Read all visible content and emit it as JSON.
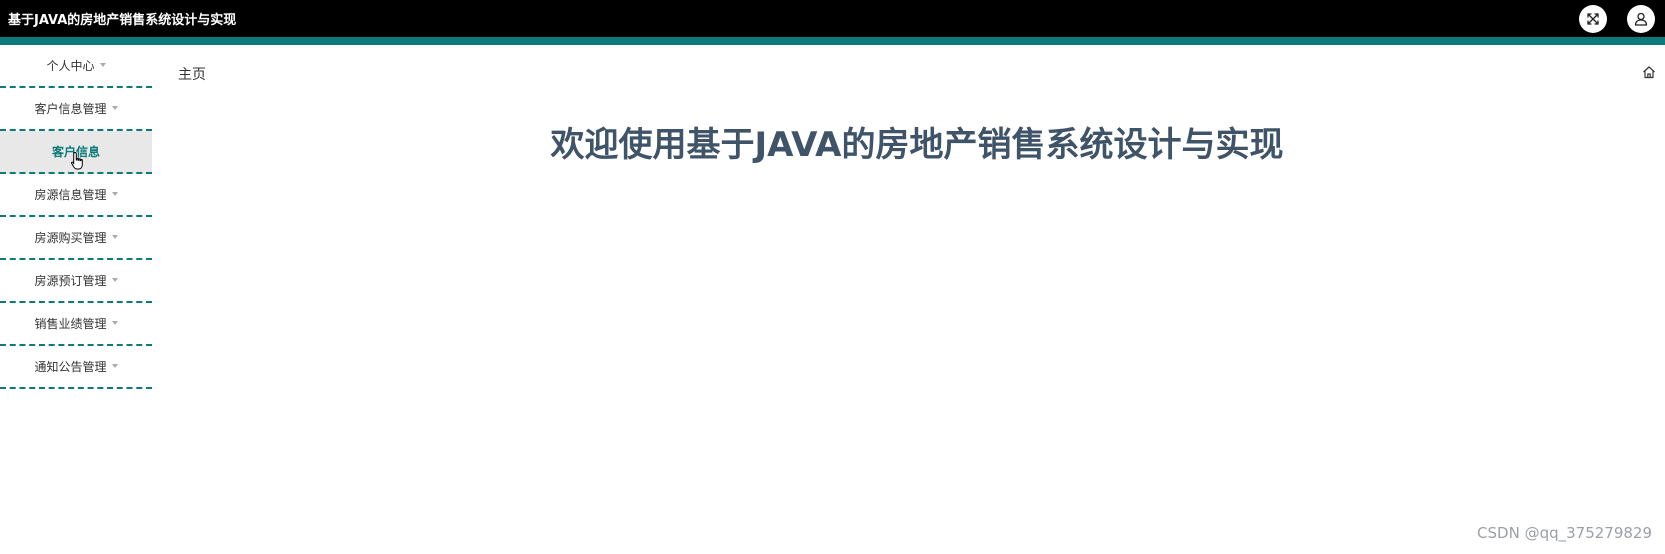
{
  "header": {
    "title": "基于JAVA的房地产销售系统设计与实现",
    "fullscreen_icon": "expand-icon",
    "user_icon": "user-icon"
  },
  "colors": {
    "accent": "#0b7a79",
    "topbar": "#000000",
    "title": "#3f5468"
  },
  "sidebar": {
    "items": [
      {
        "label": "个人中心"
      },
      {
        "label": "客户信息管理"
      },
      {
        "label": "客户信息"
      },
      {
        "label": "房源信息管理"
      },
      {
        "label": "房源购买管理"
      },
      {
        "label": "房源预订管理"
      },
      {
        "label": "销售业绩管理"
      },
      {
        "label": "通知公告管理"
      }
    ]
  },
  "main": {
    "breadcrumb": "主页",
    "welcome": "欢迎使用基于JAVA的房地产销售系统设计与实现"
  },
  "watermark": "CSDN @qq_375279829"
}
